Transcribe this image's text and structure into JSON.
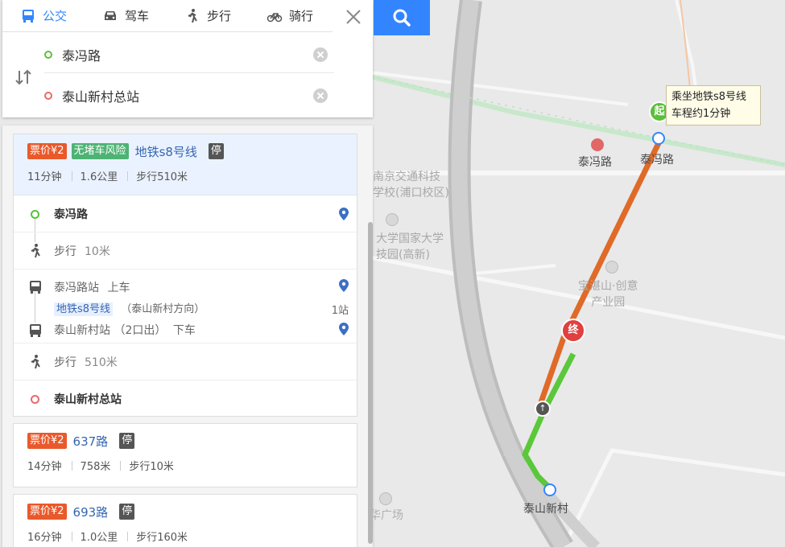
{
  "tabs": [
    {
      "label": "公交",
      "icon": "bus-icon",
      "active": true
    },
    {
      "label": "驾车",
      "icon": "car-icon",
      "active": false
    },
    {
      "label": "步行",
      "icon": "walk-icon",
      "active": false
    },
    {
      "label": "骑行",
      "icon": "bike-icon",
      "active": false
    }
  ],
  "route": {
    "origin": "泰冯路",
    "destination": "泰山新村总站"
  },
  "results": [
    {
      "price": "票价¥2",
      "risk": "无堵车风险",
      "line": "地铁s8号线",
      "stop_tag": "停",
      "time": "11分钟",
      "distance": "1.6公里",
      "walk": "步行510米",
      "steps": {
        "start": "泰冯路",
        "walk1_label": "步行",
        "walk1_dist": "10米",
        "board_station": "泰冯路站",
        "board_action": "上车",
        "line_box": "地铁s8号线",
        "direction": "（泰山新村方向）",
        "stops": "1站",
        "alight_station": "泰山新村站",
        "alight_exit": "（2口出）",
        "alight_action": "下车",
        "walk2_label": "步行",
        "walk2_dist": "510米",
        "end": "泰山新村总站"
      }
    },
    {
      "price": "票价¥2",
      "line": "637路",
      "stop_tag": "停",
      "time": "14分钟",
      "distance": "758米",
      "walk": "步行10米"
    },
    {
      "price": "票价¥2",
      "line": "693路",
      "stop_tag": "停",
      "time": "16分钟",
      "distance": "1.0公里",
      "walk": "步行160米"
    }
  ],
  "map": {
    "labels": {
      "tai_feng_lu_poi": "泰冯路",
      "tai_feng_lu_station": "泰冯路",
      "school": "南京交通科技\n学校(浦口校区)",
      "univ": "大学国家大学\n技园(高新)",
      "industrial": "宝湛山·创意\n产业园",
      "taishan_station": "泰山新村",
      "square": "华广场"
    },
    "tooltip_line1": "乘坐地铁s8号线",
    "tooltip_line2": "车程约1分钟",
    "start_marker": "起",
    "end_marker": "终"
  },
  "colors": {
    "accent": "#3385ff",
    "price_tag": "#e9592b",
    "risk_tag": "#4db374",
    "metro_route": "#e06a28",
    "walk_route": "#5ac83a"
  }
}
